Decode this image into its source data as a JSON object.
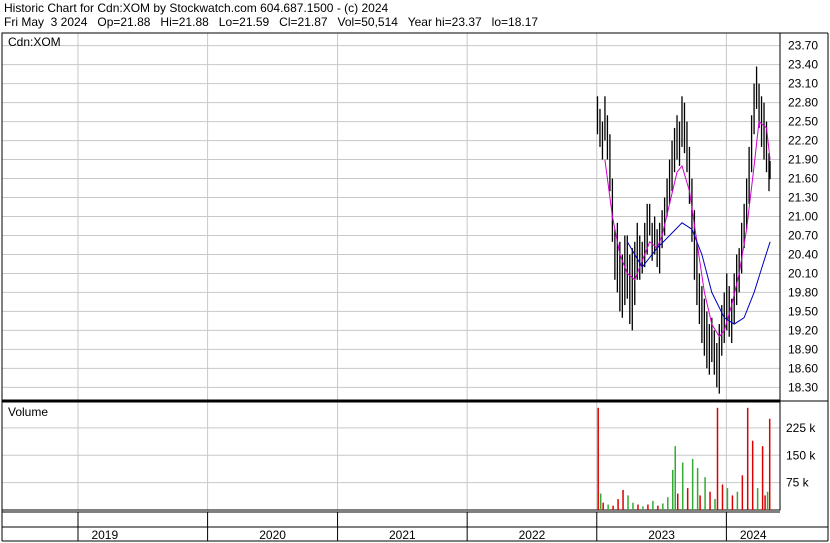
{
  "header": {
    "line1": "Historic Chart for Cdn:XOM by Stockwatch.com 604.687.1500 - (c) 2024",
    "line2": "Fri May  3 2024   Op=21.88   Hi=21.88   Lo=21.59   Cl=21.87   Vol=50,514   Year hi=23.37   lo=18.17"
  },
  "symbol_label": "Cdn:XOM",
  "volume_label": "Volume",
  "colors": {
    "price": "#000000",
    "ma_short": "#d000d0",
    "ma_long": "#0000c0",
    "vol_down": "#dd0000",
    "vol_up": "#33aa33",
    "grid": "#c8c8c8"
  },
  "chart_data": [
    {
      "type": "line",
      "title": "Historic Chart for Cdn:XOM",
      "series": [
        {
          "values": [
            {
              "date": "2023-01-03",
              "high": 22.9,
              "low": 22.3
            },
            {
              "date": "2023-01-10",
              "high": 22.7,
              "low": 22.1
            },
            {
              "date": "2023-01-17",
              "high": 22.5,
              "low": 21.9
            },
            {
              "date": "2023-01-24",
              "high": 22.9,
              "low": 22.2
            },
            {
              "date": "2023-01-31",
              "high": 22.6,
              "low": 21.9
            },
            {
              "date": "2023-02-07",
              "high": 22.3,
              "low": 21.4
            },
            {
              "date": "2023-02-14",
              "high": 21.6,
              "low": 20.6
            },
            {
              "date": "2023-02-21",
              "high": 20.8,
              "low": 20.0
            },
            {
              "date": "2023-02-28",
              "high": 20.9,
              "low": 19.8
            },
            {
              "date": "2023-03-07",
              "high": 20.6,
              "low": 19.5
            },
            {
              "date": "2023-03-14",
              "high": 20.4,
              "low": 19.4
            },
            {
              "date": "2023-03-21",
              "high": 20.7,
              "low": 19.6
            },
            {
              "date": "2023-03-28",
              "high": 20.7,
              "low": 19.7
            },
            {
              "date": "2023-04-04",
              "high": 20.4,
              "low": 19.3
            },
            {
              "date": "2023-04-11",
              "high": 20.5,
              "low": 19.2
            },
            {
              "date": "2023-04-18",
              "high": 20.6,
              "low": 19.6
            },
            {
              "date": "2023-04-25",
              "high": 20.9,
              "low": 20.0
            },
            {
              "date": "2023-05-02",
              "high": 20.7,
              "low": 20.0
            },
            {
              "date": "2023-05-09",
              "high": 20.6,
              "low": 20.1
            },
            {
              "date": "2023-05-16",
              "high": 20.9,
              "low": 20.2
            },
            {
              "date": "2023-05-23",
              "high": 21.2,
              "low": 20.4
            },
            {
              "date": "2023-05-30",
              "high": 21.2,
              "low": 20.7
            },
            {
              "date": "2023-06-06",
              "high": 20.9,
              "low": 20.3
            },
            {
              "date": "2023-06-13",
              "high": 21.0,
              "low": 20.4
            },
            {
              "date": "2023-06-20",
              "high": 20.8,
              "low": 20.2
            },
            {
              "date": "2023-06-27",
              "high": 20.9,
              "low": 20.1
            },
            {
              "date": "2023-07-04",
              "high": 21.1,
              "low": 20.5
            },
            {
              "date": "2023-07-11",
              "high": 21.3,
              "low": 20.7
            },
            {
              "date": "2023-07-18",
              "high": 21.6,
              "low": 21.0
            },
            {
              "date": "2023-07-25",
              "high": 21.9,
              "low": 21.2
            },
            {
              "date": "2023-08-01",
              "high": 22.2,
              "low": 21.4
            },
            {
              "date": "2023-08-08",
              "high": 22.4,
              "low": 21.7
            },
            {
              "date": "2023-08-15",
              "high": 22.6,
              "low": 21.9
            },
            {
              "date": "2023-08-22",
              "high": 22.5,
              "low": 21.8
            },
            {
              "date": "2023-08-29",
              "high": 22.9,
              "low": 22.1
            },
            {
              "date": "2023-09-05",
              "high": 22.8,
              "low": 22.0
            },
            {
              "date": "2023-09-12",
              "high": 22.5,
              "low": 21.7
            },
            {
              "date": "2023-09-19",
              "high": 22.1,
              "low": 21.2
            },
            {
              "date": "2023-09-26",
              "high": 21.6,
              "low": 20.6
            },
            {
              "date": "2023-10-03",
              "high": 21.1,
              "low": 20.0
            },
            {
              "date": "2023-10-10",
              "high": 20.6,
              "low": 19.6
            },
            {
              "date": "2023-10-17",
              "high": 20.1,
              "low": 19.3
            },
            {
              "date": "2023-10-24",
              "high": 19.9,
              "low": 19.0
            },
            {
              "date": "2023-10-31",
              "high": 19.7,
              "low": 18.8
            },
            {
              "date": "2023-11-07",
              "high": 19.5,
              "low": 18.6
            },
            {
              "date": "2023-11-14",
              "high": 19.3,
              "low": 18.5
            },
            {
              "date": "2023-11-21",
              "high": 19.4,
              "low": 18.7
            },
            {
              "date": "2023-11-28",
              "high": 19.2,
              "low": 18.5
            },
            {
              "date": "2023-12-05",
              "high": 19.0,
              "low": 18.3
            },
            {
              "date": "2023-12-12",
              "high": 19.3,
              "low": 18.2
            },
            {
              "date": "2023-12-19",
              "high": 19.6,
              "low": 18.8
            },
            {
              "date": "2023-12-26",
              "high": 19.8,
              "low": 19.0
            },
            {
              "date": "2024-01-02",
              "high": 20.1,
              "low": 19.2
            },
            {
              "date": "2024-01-09",
              "high": 19.9,
              "low": 19.1
            },
            {
              "date": "2024-01-16",
              "high": 19.7,
              "low": 19.0
            },
            {
              "date": "2024-01-23",
              "high": 20.1,
              "low": 19.3
            },
            {
              "date": "2024-01-30",
              "high": 20.4,
              "low": 19.6
            },
            {
              "date": "2024-02-06",
              "high": 20.5,
              "low": 19.8
            },
            {
              "date": "2024-02-13",
              "high": 20.9,
              "low": 20.1
            },
            {
              "date": "2024-02-20",
              "high": 21.2,
              "low": 20.5
            },
            {
              "date": "2024-02-27",
              "high": 21.6,
              "low": 20.8
            },
            {
              "date": "2024-03-05",
              "high": 22.1,
              "low": 21.2
            },
            {
              "date": "2024-03-12",
              "high": 22.6,
              "low": 21.7
            },
            {
              "date": "2024-03-19",
              "high": 23.1,
              "low": 22.3
            },
            {
              "date": "2024-03-26",
              "high": 23.37,
              "low": 22.7
            },
            {
              "date": "2024-04-02",
              "high": 23.1,
              "low": 22.4
            },
            {
              "date": "2024-04-09",
              "high": 22.9,
              "low": 22.1
            },
            {
              "date": "2024-04-16",
              "high": 22.8,
              "low": 21.9
            },
            {
              "date": "2024-04-23",
              "high": 22.5,
              "low": 21.7
            },
            {
              "date": "2024-04-30",
              "high": 22.0,
              "low": 21.4
            },
            {
              "date": "2024-05-03",
              "high": 21.88,
              "low": 21.59
            }
          ],
          "color": "#000000"
        },
        {
          "values": [
            [
              "2023-01-24",
              21.9
            ],
            [
              "2023-02-14",
              21.0
            ],
            [
              "2023-03-07",
              20.4
            ],
            [
              "2023-03-28",
              20.1
            ],
            [
              "2023-04-18",
              20.0
            ],
            [
              "2023-05-09",
              20.3
            ],
            [
              "2023-05-30",
              20.6
            ],
            [
              "2023-06-20",
              20.5
            ],
            [
              "2023-07-04",
              20.7
            ],
            [
              "2023-07-25",
              21.2
            ],
            [
              "2023-08-15",
              21.7
            ],
            [
              "2023-08-29",
              21.8
            ],
            [
              "2023-09-19",
              21.4
            ],
            [
              "2023-10-10",
              20.6
            ],
            [
              "2023-10-31",
              19.8
            ],
            [
              "2023-11-21",
              19.3
            ],
            [
              "2023-12-12",
              19.1
            ],
            [
              "2023-12-26",
              19.2
            ],
            [
              "2024-01-16",
              19.6
            ],
            [
              "2024-02-06",
              20.1
            ],
            [
              "2024-02-27",
              20.8
            ],
            [
              "2024-03-19",
              21.8
            ],
            [
              "2024-04-02",
              22.5
            ],
            [
              "2024-04-23",
              22.4
            ],
            [
              "2024-05-03",
              21.9
            ]
          ],
          "color": "#d000d0"
        },
        {
          "values": [
            [
              "2023-03-28",
              20.6
            ],
            [
              "2023-05-09",
              20.2
            ],
            [
              "2023-06-20",
              20.5
            ],
            [
              "2023-07-25",
              20.7
            ],
            [
              "2023-08-29",
              20.9
            ],
            [
              "2023-09-26",
              20.8
            ],
            [
              "2023-10-24",
              20.4
            ],
            [
              "2023-11-21",
              19.8
            ],
            [
              "2023-12-26",
              19.4
            ],
            [
              "2024-01-23",
              19.3
            ],
            [
              "2024-02-20",
              19.4
            ],
            [
              "2024-03-19",
              19.8
            ],
            [
              "2024-04-16",
              20.3
            ],
            [
              "2024-05-03",
              20.6
            ]
          ],
          "color": "#0000c0"
        }
      ],
      "x_ticks": [
        "2019",
        "2020",
        "2021",
        "2022",
        "2023",
        "2024"
      ],
      "y_ticks": [
        23.7,
        23.4,
        23.1,
        22.8,
        22.5,
        22.2,
        21.9,
        21.6,
        21.3,
        21.0,
        20.7,
        20.4,
        20.1,
        19.8,
        19.5,
        19.2,
        18.9,
        18.6,
        18.3
      ],
      "ylim": [
        18.1,
        23.9
      ],
      "xlim": [
        "2018-06-01",
        "2024-05-31"
      ],
      "grid": true
    },
    {
      "type": "bar",
      "title": "Volume",
      "series": [
        {
          "values": [
            [
              "2023-01-05",
              280000,
              "down"
            ],
            [
              "2023-01-12",
              45000,
              "up"
            ],
            [
              "2023-01-19",
              20000,
              "down"
            ],
            [
              "2023-02-02",
              15000,
              "up"
            ],
            [
              "2023-02-16",
              12000,
              "down"
            ],
            [
              "2023-03-02",
              30000,
              "down"
            ],
            [
              "2023-03-16",
              55000,
              "down"
            ],
            [
              "2023-03-30",
              40000,
              "up"
            ],
            [
              "2023-04-13",
              20000,
              "up"
            ],
            [
              "2023-04-27",
              15000,
              "down"
            ],
            [
              "2023-05-11",
              10000,
              "up"
            ],
            [
              "2023-05-25",
              15000,
              "down"
            ],
            [
              "2023-06-08",
              25000,
              "up"
            ],
            [
              "2023-06-22",
              12000,
              "down"
            ],
            [
              "2023-07-06",
              18000,
              "up"
            ],
            [
              "2023-07-20",
              35000,
              "up"
            ],
            [
              "2023-08-03",
              110000,
              "up"
            ],
            [
              "2023-08-10",
              175000,
              "up"
            ],
            [
              "2023-08-17",
              45000,
              "down"
            ],
            [
              "2023-08-31",
              130000,
              "up"
            ],
            [
              "2023-09-14",
              60000,
              "down"
            ],
            [
              "2023-09-28",
              140000,
              "up"
            ],
            [
              "2023-10-12",
              115000,
              "up"
            ],
            [
              "2023-10-19",
              40000,
              "down"
            ],
            [
              "2023-11-02",
              90000,
              "up"
            ],
            [
              "2023-11-16",
              50000,
              "down"
            ],
            [
              "2023-11-30",
              30000,
              "up"
            ],
            [
              "2023-12-07",
              280000,
              "down"
            ],
            [
              "2023-12-21",
              70000,
              "down"
            ],
            [
              "2024-01-04",
              60000,
              "up"
            ],
            [
              "2024-01-18",
              40000,
              "down"
            ],
            [
              "2024-02-01",
              50000,
              "up"
            ],
            [
              "2024-02-15",
              95000,
              "down"
            ],
            [
              "2024-03-01",
              280000,
              "down"
            ],
            [
              "2024-03-15",
              190000,
              "down"
            ],
            [
              "2024-03-29",
              60000,
              "up"
            ],
            [
              "2024-04-12",
              175000,
              "down"
            ],
            [
              "2024-04-19",
              40000,
              "down"
            ],
            [
              "2024-04-26",
              50000,
              "up"
            ],
            [
              "2024-05-02",
              250000,
              "down"
            ]
          ],
          "color": "#dd0000"
        }
      ],
      "y_ticks": [
        "225 k",
        "150 k",
        "75 k"
      ],
      "ylim": [
        0,
        285000
      ],
      "grid": true
    }
  ]
}
